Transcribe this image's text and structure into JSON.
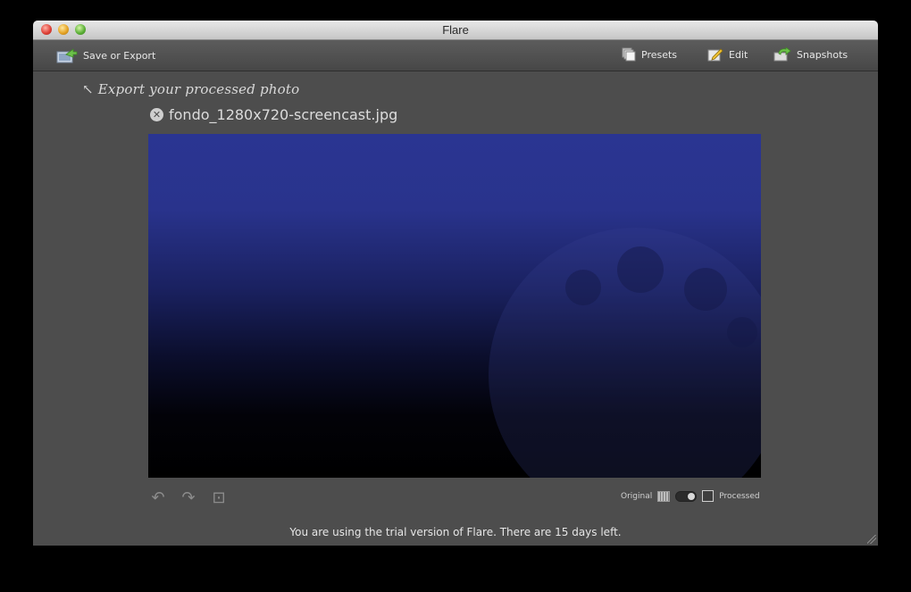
{
  "window": {
    "title": "Flare"
  },
  "toolbar": {
    "save_export_label": "Save or Export",
    "presets_label": "Presets",
    "edit_label": "Edit",
    "snapshots_label": "Snapshots"
  },
  "hint": {
    "text": "Export your processed photo"
  },
  "file": {
    "name": "fondo_1280x720-screencast.jpg"
  },
  "compare": {
    "original_label": "Original",
    "processed_label": "Processed"
  },
  "status": {
    "trial_message": "You are using the trial version of Flare. There are 15 days left."
  },
  "icons": {
    "close": "close-circle-icon",
    "undo": "undo-icon",
    "redo": "redo-icon",
    "crop": "crop-icon",
    "export": "export-icon",
    "presets": "presets-icon",
    "edit": "edit-icon",
    "snapshots": "snapshots-icon"
  },
  "colors": {
    "window_bg": "#4d4d4d",
    "photo_blue": "#2a3592",
    "text": "#e8e8e8"
  }
}
